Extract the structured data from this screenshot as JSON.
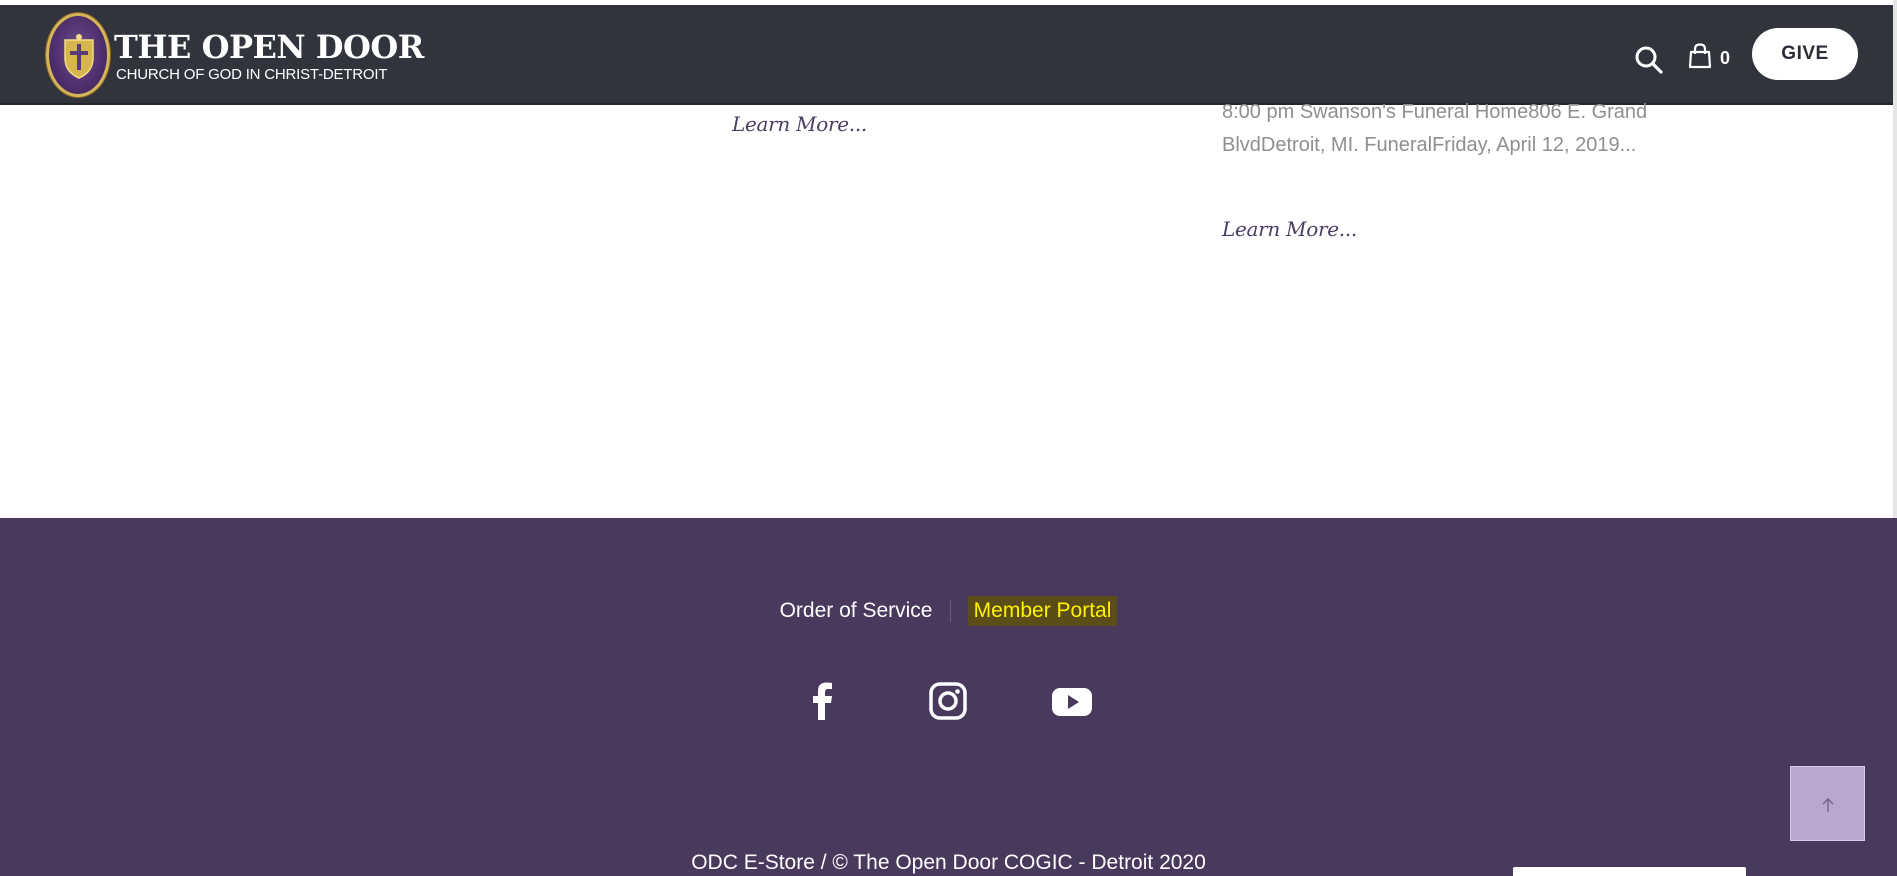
{
  "header": {
    "logo_title": "THE OPEN DOOR",
    "logo_subtitle": "CHURCH OF GOD IN CHRIST-DETROIT",
    "cart_count": "0",
    "give_label": "GIVE"
  },
  "content": {
    "learn_more_1": "Learn More...",
    "event_excerpt": "8:00 pm Swanson's Funeral Home806 E. Grand BlvdDetroit, MI. FuneralFriday, April 12, 2019...",
    "learn_more_2": "Learn More..."
  },
  "footer": {
    "links": [
      {
        "label": "Order of Service"
      },
      {
        "label": "Member Portal"
      }
    ],
    "social": [
      "facebook-icon",
      "instagram-icon",
      "youtube-icon"
    ],
    "copyright": "ODC E-Store / © The Open Door COGIC - Detroit 2020"
  },
  "colors": {
    "header_bg": "#31343d",
    "footer_bg": "#48395d",
    "accent_purple": "#4b3d63",
    "highlight_text": "#fff200",
    "back_to_top_bg": "#b9a6d1"
  }
}
